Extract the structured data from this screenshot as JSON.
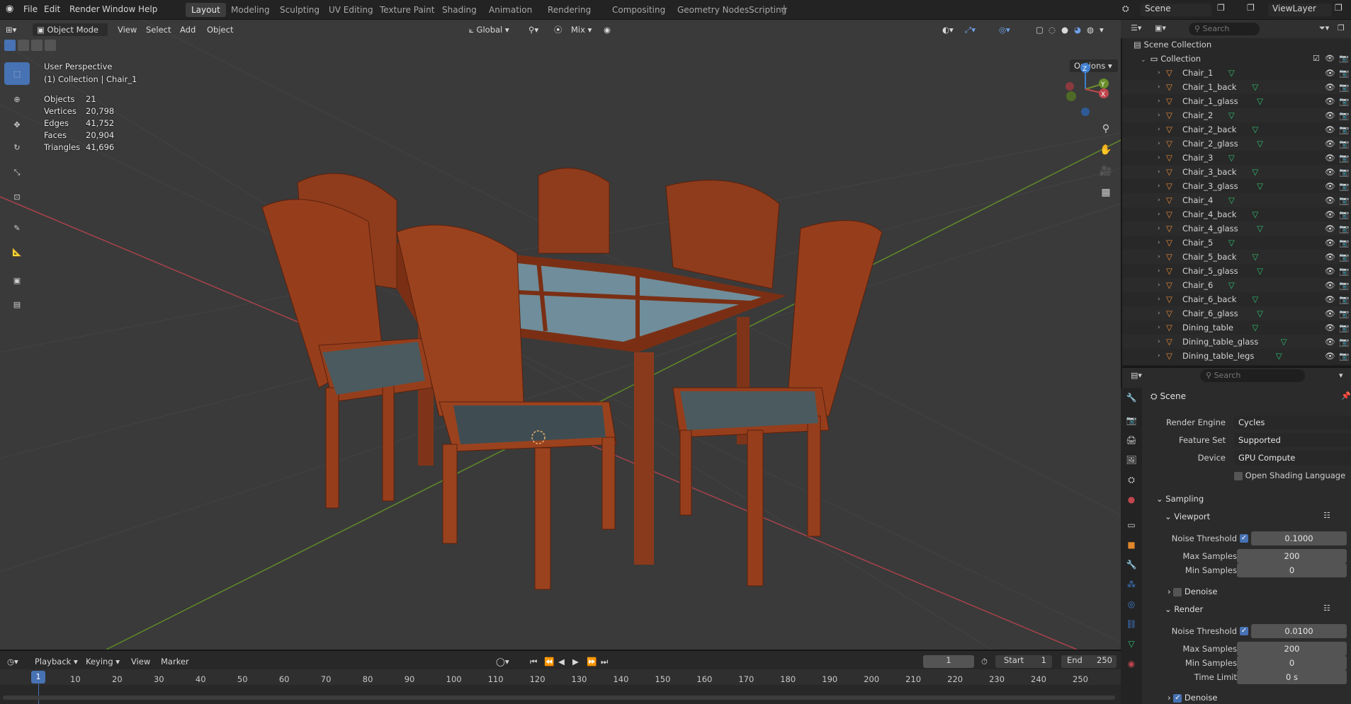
{
  "menu": {
    "file": "File",
    "edit": "Edit",
    "render": "Render",
    "window": "Window",
    "help": "Help"
  },
  "workspaces": [
    "Layout",
    "Modeling",
    "Sculpting",
    "UV Editing",
    "Texture Paint",
    "Shading",
    "Animation",
    "Rendering",
    "Compositing",
    "Geometry Nodes",
    "Scripting"
  ],
  "top_right": {
    "scene": "Scene",
    "viewlayer": "ViewLayer"
  },
  "viewport_header": {
    "mode": "Object Mode",
    "view": "View",
    "select": "Select",
    "add": "Add",
    "object": "Object",
    "orientation": "Global",
    "mix": "Mix",
    "options": "Options"
  },
  "overlay": {
    "perspective": "User Perspective",
    "collection": "(1) Collection | Chair_1",
    "stats": [
      {
        "label": "Objects",
        "value": "21"
      },
      {
        "label": "Vertices",
        "value": "20,798"
      },
      {
        "label": "Edges",
        "value": "41,752"
      },
      {
        "label": "Faces",
        "value": "20,904"
      },
      {
        "label": "Triangles",
        "value": "41,696"
      }
    ]
  },
  "outliner": {
    "search_placeholder": "Search",
    "scene_collection": "Scene Collection",
    "collection": "Collection",
    "items": [
      "Chair_1",
      "Chair_1_back",
      "Chair_1_glass",
      "Chair_2",
      "Chair_2_back",
      "Chair_2_glass",
      "Chair_3",
      "Chair_3_back",
      "Chair_3_glass",
      "Chair_4",
      "Chair_4_back",
      "Chair_4_glass",
      "Chair_5",
      "Chair_5_back",
      "Chair_5_glass",
      "Chair_6",
      "Chair_6_back",
      "Chair_6_glass",
      "Dining_table",
      "Dining_table_glass",
      "Dining_table_legs"
    ]
  },
  "properties": {
    "search_placeholder": "Search",
    "context": "Scene",
    "render_engine_label": "Render Engine",
    "render_engine": "Cycles",
    "feature_set_label": "Feature Set",
    "feature_set": "Supported",
    "device_label": "Device",
    "device": "GPU Compute",
    "osl": "Open Shading Language",
    "sampling": "Sampling",
    "viewport": "Viewport",
    "vp_noise_label": "Noise Threshold",
    "vp_noise": "0.1000",
    "vp_max_label": "Max Samples",
    "vp_max": "200",
    "vp_min_label": "Min Samples",
    "vp_min": "0",
    "denoise": "Denoise",
    "render": "Render",
    "r_noise_label": "Noise Threshold",
    "r_noise": "0.0100",
    "r_max_label": "Max Samples",
    "r_max": "200",
    "r_min_label": "Min Samples",
    "r_min": "0",
    "time_limit_label": "Time Limit",
    "time_limit": "0 s",
    "denoise2": "Denoise"
  },
  "timeline": {
    "playback": "Playback",
    "keying": "Keying",
    "view": "View",
    "marker": "Marker",
    "current": "1",
    "start_label": "Start",
    "start": "1",
    "end_label": "End",
    "end": "250",
    "ticks": [
      "1",
      "10",
      "20",
      "30",
      "40",
      "50",
      "60",
      "70",
      "80",
      "90",
      "100",
      "110",
      "120",
      "130",
      "140",
      "150",
      "160",
      "170",
      "180",
      "190",
      "200",
      "210",
      "220",
      "230",
      "240",
      "250"
    ]
  },
  "colors": {
    "accent": "#4772b3",
    "wood": "#8a3a1c",
    "axis_x": "#c0464d",
    "axis_y": "#6a8f2a",
    "axis_z": "#3f7fd1"
  }
}
